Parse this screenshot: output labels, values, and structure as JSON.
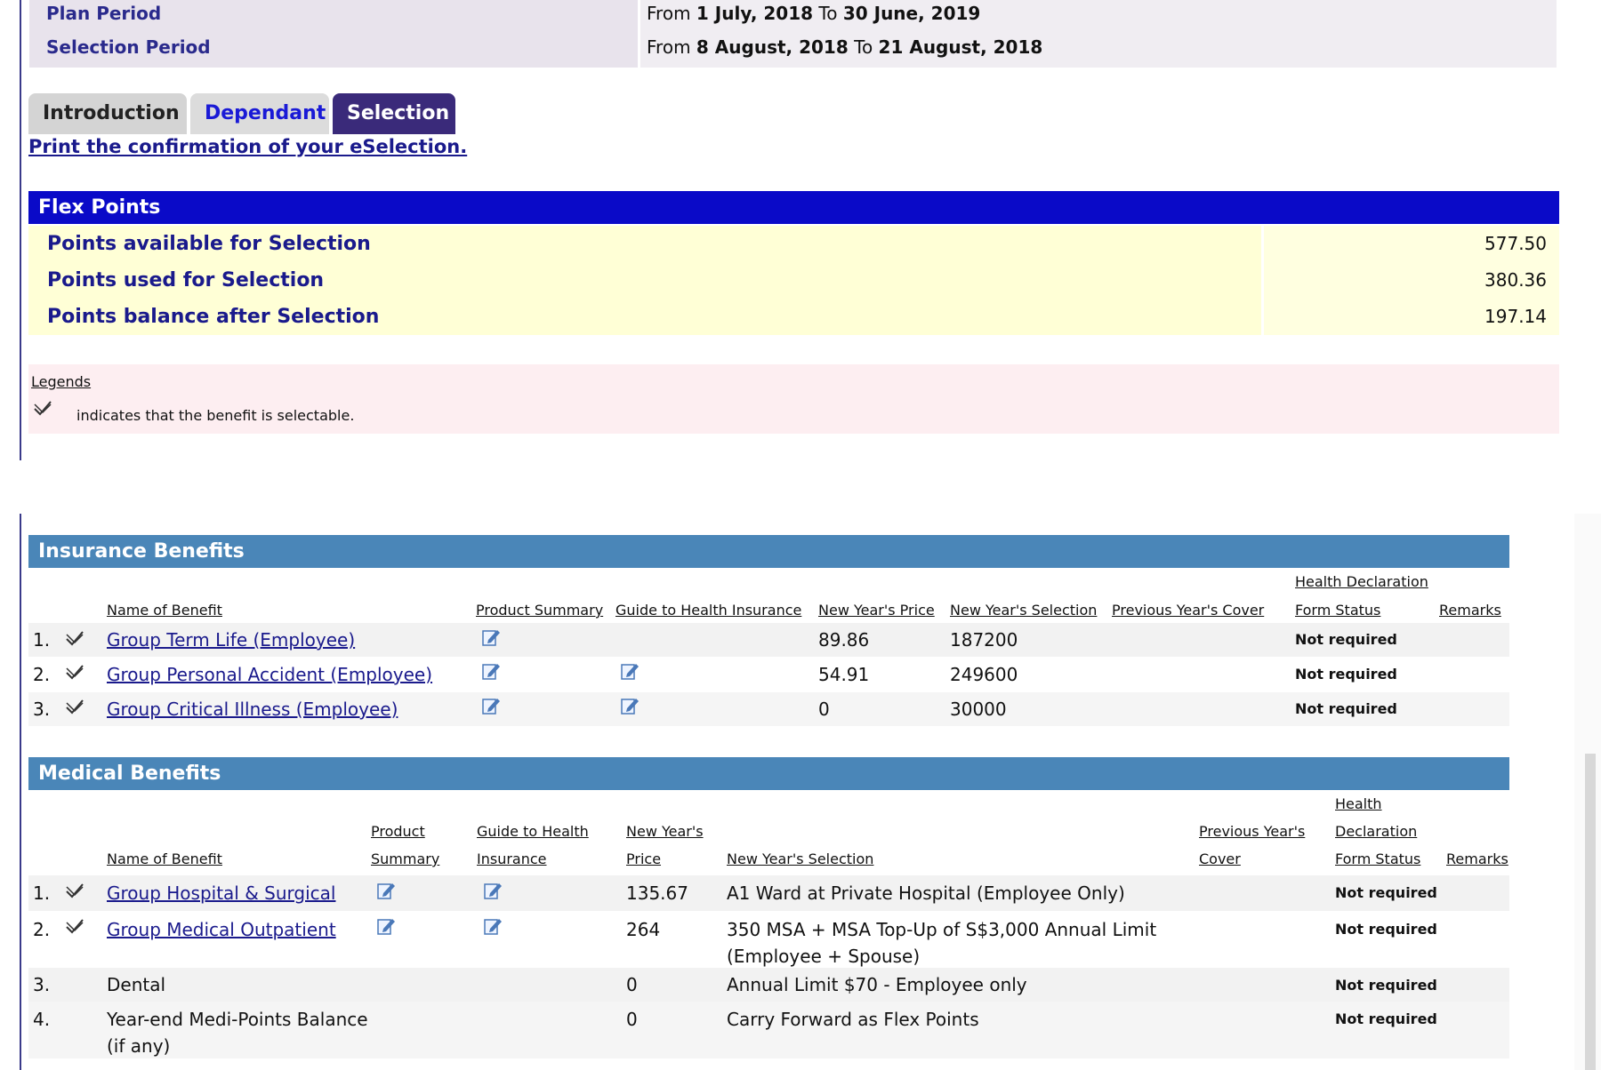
{
  "period": {
    "plan_label": "Plan Period",
    "plan_prefix": "From",
    "plan_from": "1 July, 2018",
    "plan_mid": "To",
    "plan_to": "30 June, 2019",
    "selection_label": "Selection Period",
    "selection_prefix": "From",
    "selection_from": "8 August, 2018",
    "selection_mid": "To",
    "selection_to": "21 August, 2018"
  },
  "tabs": {
    "intro": "Introduction",
    "dependant": "Dependant",
    "selection": "Selection"
  },
  "print_link": "Print the confirmation of your eSelection.",
  "flex": {
    "title": "Flex Points",
    "rows": [
      {
        "label": "Points available for Selection",
        "value": "577.50"
      },
      {
        "label": "Points used for Selection",
        "value": "380.36"
      },
      {
        "label": "Points balance after Selection",
        "value": "197.14"
      }
    ]
  },
  "legend": {
    "title": "Legends",
    "text": "indicates that the benefit is selectable.",
    "icon": "selectable-icon"
  },
  "insurance": {
    "title": "Insurance Benefits",
    "headers": {
      "name": "Name of Benefit",
      "summary": "Product Summary",
      "guide": "Guide to Health Insurance",
      "price": "New Year's Price",
      "selection": "New Year's Selection",
      "prev": "Previous Year's Cover",
      "hd1": "Health Declaration",
      "hd2": "Form Status",
      "remarks": "Remarks"
    },
    "rows": [
      {
        "num": "1.",
        "name": "Group Term Life (Employee)",
        "price": "89.86",
        "selection": "187200",
        "status": "Not required"
      },
      {
        "num": "2.",
        "name": "Group Personal Accident (Employee)",
        "price": "54.91",
        "selection": "249600",
        "status": "Not required"
      },
      {
        "num": "3.",
        "name": "Group Critical Illness (Employee)",
        "price": "0",
        "selection": "30000",
        "status": "Not required"
      }
    ]
  },
  "medical": {
    "title": "Medical Benefits",
    "headers": {
      "name": "Name of Benefit",
      "summary1": "Product",
      "summary2": "Summary",
      "guide1": "Guide to Health",
      "guide2": "Insurance",
      "price1": "New Year's",
      "price2": "Price",
      "selection": "New Year's Selection",
      "prev1": "Previous Year's",
      "prev2": "Cover",
      "hd1": "Health",
      "hd2": "Declaration",
      "hd3": "Form Status",
      "remarks": "Remarks"
    },
    "rows": [
      {
        "num": "1.",
        "name": "Group Hospital & Surgical",
        "price": "135.67",
        "selection": "A1 Ward at Private Hospital (Employee Only)",
        "selection2": "",
        "status": "Not required"
      },
      {
        "num": "2.",
        "name": "Group Medical Outpatient",
        "price": "264",
        "selection": "350 MSA + MSA Top-Up of S$3,000 Annual Limit",
        "selection2": "(Employee + Spouse)",
        "status": "Not required"
      },
      {
        "num": "3.",
        "name": "Dental",
        "name2": "",
        "price": "0",
        "selection": "Annual Limit $70 - Employee only",
        "selection2": "",
        "status": "Not required"
      },
      {
        "num": "4.",
        "name": "Year-end Medi-Points Balance",
        "name2": "(if any)",
        "price": "0",
        "selection": "Carry Forward as Flex Points",
        "selection2": "",
        "status": "Not required"
      }
    ]
  },
  "colors": {
    "flex_header": "#0a0ac8",
    "section_header": "#4a86b8",
    "tab_active": "#3a2a7a",
    "points_bg": "#ffffd6",
    "legend_bg": "#fdeef1"
  }
}
